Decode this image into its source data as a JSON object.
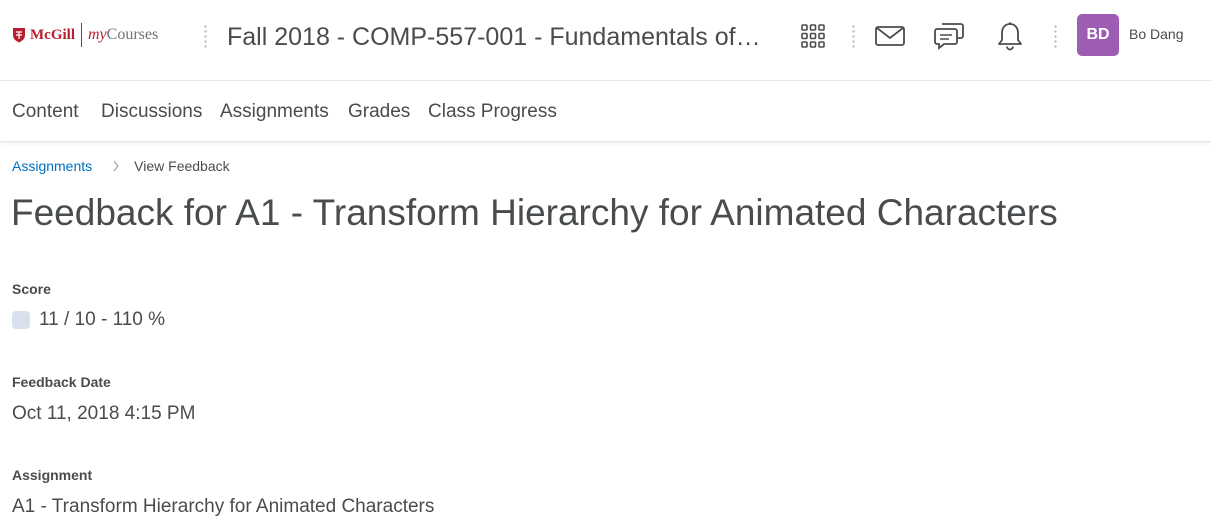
{
  "header": {
    "logo_brand": "McGill",
    "logo_product_prefix": "my",
    "logo_product_suffix": "Courses",
    "course_title": "Fall 2018 - COMP-557-001 - Fundamentals of…",
    "icons": [
      "grid-icon",
      "mail-icon",
      "chat-icon",
      "bell-icon"
    ],
    "user": {
      "initials": "BD",
      "name": "Bo Dang",
      "avatar_color": "#9d5db3"
    }
  },
  "nav": {
    "items": [
      "Content",
      "Discussions",
      "Assignments",
      "Grades",
      "Class Progress"
    ]
  },
  "breadcrumb": {
    "parent": "Assignments",
    "current": "View Feedback"
  },
  "page": {
    "title": "Feedback for A1 - Transform Hierarchy for Animated Characters",
    "score_label": "Score",
    "score_value": "11 / 10 - 110 %",
    "feedback_date_label": "Feedback Date",
    "feedback_date_value": "Oct 11, 2018 4:15 PM",
    "assignment_label": "Assignment",
    "assignment_value": "A1 - Transform Hierarchy for Animated Characters"
  },
  "colors": {
    "brand_red": "#b8202f",
    "link_blue": "#006fbf",
    "text": "#494c4e",
    "score_swatch": "#d8e0ec"
  }
}
